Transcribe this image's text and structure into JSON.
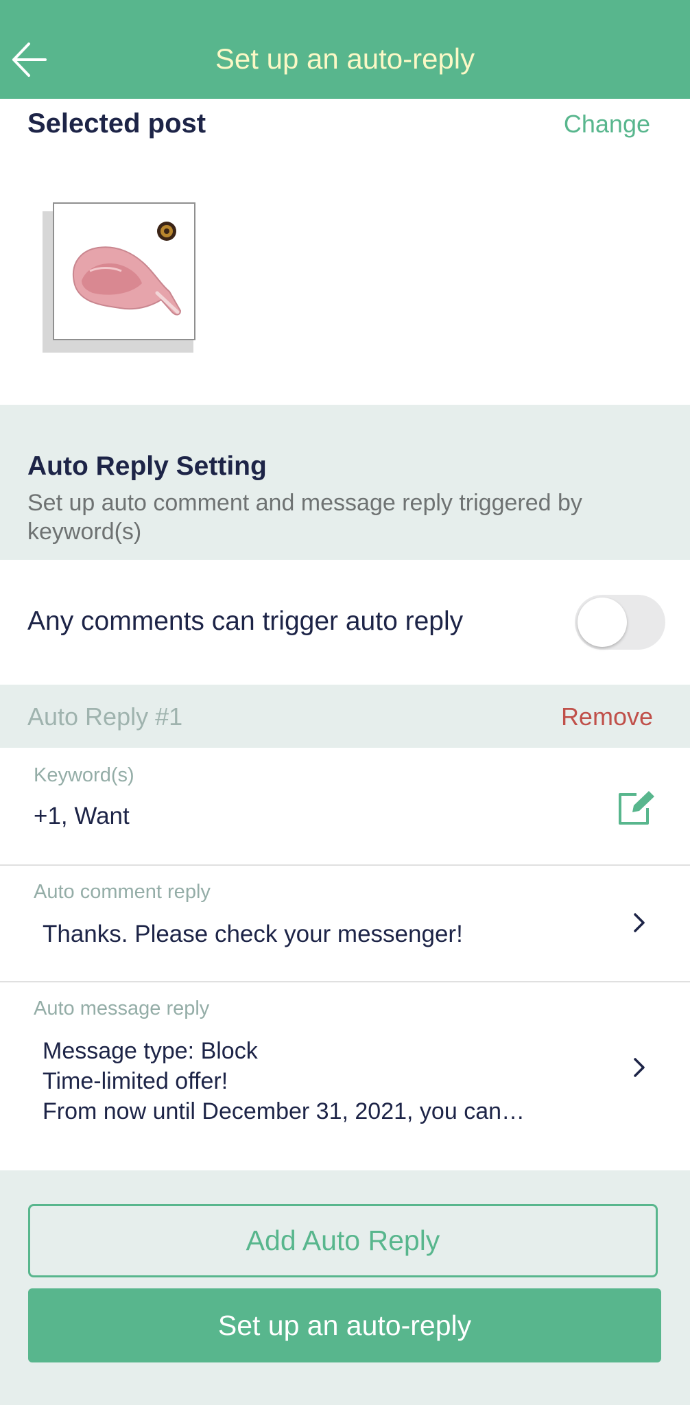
{
  "header": {
    "title": "Set up an auto-reply"
  },
  "selected_post": {
    "title": "Selected post",
    "change_label": "Change"
  },
  "settings": {
    "title": "Auto Reply Setting",
    "description": "Set up auto comment and message reply triggered by keyword(s)"
  },
  "any_comments": {
    "label": "Any comments can trigger auto reply",
    "enabled": false
  },
  "auto_reply": {
    "header_label": "Auto Reply #1",
    "remove_label": "Remove",
    "keywords": {
      "label": "Keyword(s)",
      "value": "+1, Want"
    },
    "comment": {
      "label": "Auto comment reply",
      "value": "Thanks. Please check your messenger!"
    },
    "message": {
      "label": "Auto message reply",
      "lines": [
        "Message type: Block",
        "Time-limited offer!",
        "From now until December 31, 2021, you can…"
      ]
    }
  },
  "buttons": {
    "add_label": "Add Auto Reply",
    "setup_label": "Set up an auto-reply"
  },
  "colors": {
    "brand": "#58b68d",
    "header_title": "#fbf8c6",
    "remove": "#c0504a",
    "background": "#e6eeec"
  },
  "icons": {
    "back": "arrow-left-icon",
    "edit": "edit-icon",
    "chevron": "chevron-right-icon"
  }
}
